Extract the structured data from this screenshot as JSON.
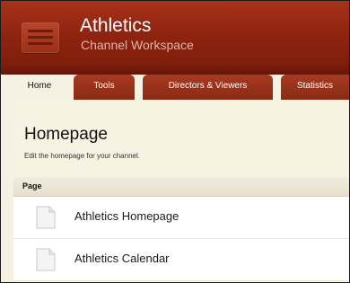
{
  "header": {
    "title": "Athletics",
    "subtitle": "Channel Workspace"
  },
  "tabs": [
    {
      "label": "Home",
      "active": true
    },
    {
      "label": "Tools",
      "active": false
    },
    {
      "label": "Directors & Viewers",
      "active": false
    },
    {
      "label": "Statistics",
      "active": false
    }
  ],
  "main": {
    "title": "Homepage",
    "description": "Edit the homepage for your channel.",
    "table": {
      "column_header": "Page",
      "rows": [
        {
          "label": "Athletics Homepage",
          "icon": "document-icon"
        },
        {
          "label": "Athletics Calendar",
          "icon": "document-icon"
        }
      ]
    }
  },
  "colors": {
    "header_red": "#8e2410",
    "content_bg": "#f8f2e2"
  }
}
